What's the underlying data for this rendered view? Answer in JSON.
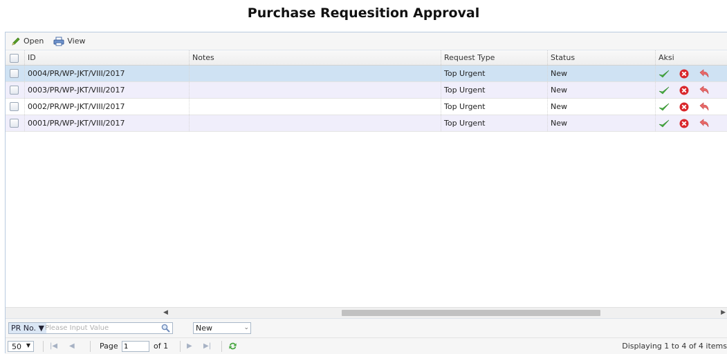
{
  "page": {
    "title": "Purchase Requesition Approval"
  },
  "toolbar": {
    "open_label": "Open",
    "view_label": "View"
  },
  "columns": {
    "id": "ID",
    "notes": "Notes",
    "request_type": "Request Type",
    "status": "Status",
    "aksi": "Aksi"
  },
  "rows": [
    {
      "id": "0004/PR/WP-JKT/VIII/2017",
      "notes": "",
      "request_type": "Top Urgent",
      "status": "New"
    },
    {
      "id": "0003/PR/WP-JKT/VIII/2017",
      "notes": "",
      "request_type": "Top Urgent",
      "status": "New"
    },
    {
      "id": "0002/PR/WP-JKT/VIII/2017",
      "notes": "",
      "request_type": "Top Urgent",
      "status": "New"
    },
    {
      "id": "0001/PR/WP-JKT/VIII/2017",
      "notes": "",
      "request_type": "Top Urgent",
      "status": "New"
    }
  ],
  "filter": {
    "field_label": "PR No.",
    "placeholder": "Please Input Value",
    "status_value": "New"
  },
  "pager": {
    "page_size": "50",
    "page_label": "Page",
    "page_value": "1",
    "of_label": "of 1",
    "display_text": "Displaying 1 to 4 of 4 items"
  },
  "colors": {
    "accept": "#3aa53a",
    "reject": "#d9262b",
    "return": "#e05a5a",
    "selected_row": "#cfe2f3",
    "alt_row": "#f0eefb"
  }
}
